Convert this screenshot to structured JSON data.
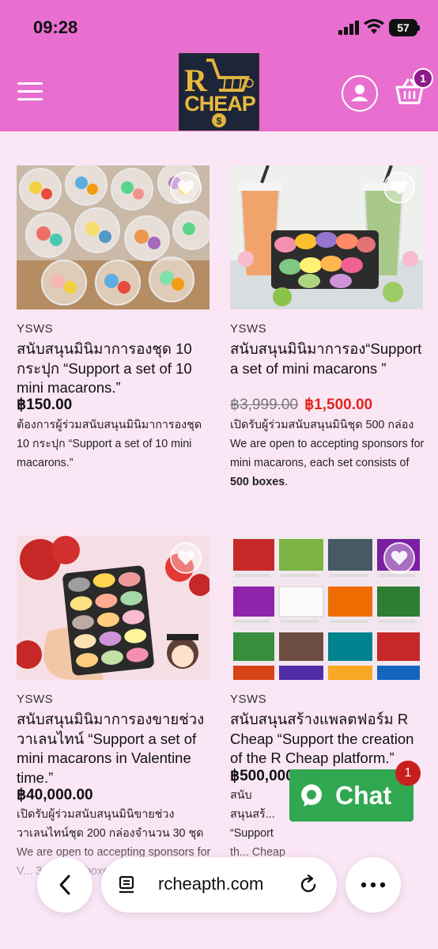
{
  "status_bar": {
    "time": "09:28",
    "battery": "57"
  },
  "header": {
    "logo_text_1": "R",
    "logo_text_2": "CHEAP",
    "cart_count": "1"
  },
  "products": [
    {
      "vendor": "YSWS",
      "title": "สนับสนุนมินิมาการองชุด 10 กระปุก “Support a set of 10 mini macarons.”",
      "price": "฿150.00",
      "description": "ต้องการผู้ร่วมสนับสนุนมินิมาการองชุด 10 กระปุก “Support a set of 10 mini macarons.”"
    },
    {
      "vendor": "YSWS",
      "title": "สนับสนุนมินิมาการอง“Support a set of mini macarons ”",
      "price_old": "฿3,999.00",
      "price_new": "฿1,500.00",
      "description_1": "เปิดรับผู้ร่วมสนับสนุนมินิชุด 500 กล่อง We are open to accepting sponsors for mini macarons, each set consists of ",
      "description_bold": "500 boxes",
      "description_2": "."
    },
    {
      "vendor": "YSWS",
      "title": "สนับสนุนมินิมาการองขายช่วงวาเลนไทน์ “Support a set of mini macarons in Valentine time.”",
      "price": "฿40,000.00",
      "description": "เปิดรับผู้ร่วมสนับสนุนมินิขายช่วงวาเลนไทน์ชุด 200 กล่องจำนวน 30 ชุด We are open to accepting sponsors for V... 30 sets... boxes)."
    },
    {
      "vendor": "YSWS",
      "title": "สนับสนุนสร้างแพลตฟอร์ม R Cheap “Support the creation of the R Cheap platform.”",
      "price": "฿500,000",
      "description": "สนับสนุนสร้... “Support th... Cheap platform.”"
    }
  ],
  "chat": {
    "label": "Chat",
    "badge": "1"
  },
  "browser": {
    "url": "rcheapth.com"
  },
  "colors": {
    "header": "#e86fcf",
    "background": "#fbe6f6",
    "sale": "#e0261b",
    "chat": "#2fa84f"
  }
}
